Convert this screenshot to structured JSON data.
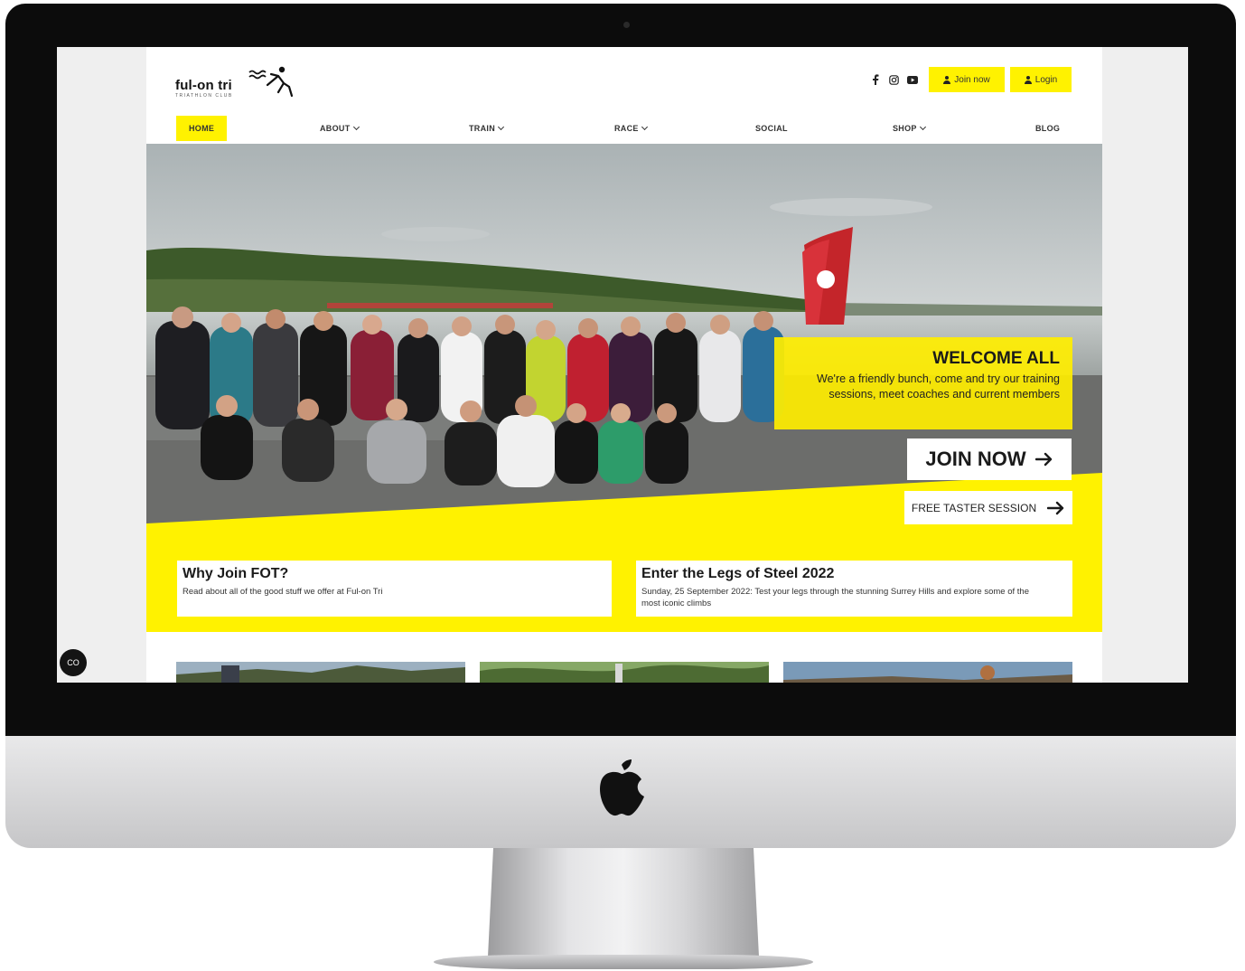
{
  "logo": {
    "text": "ful-on tri",
    "subtitle": "TRIATHLON CLUB"
  },
  "header": {
    "social_icons": [
      "facebook-icon",
      "instagram-icon",
      "youtube-icon"
    ],
    "join_label": "Join now",
    "login_label": "Login"
  },
  "nav": {
    "items": [
      {
        "label": "HOME",
        "active": true
      },
      {
        "label": "ABOUT",
        "dropdown": true
      },
      {
        "label": "TRAIN",
        "dropdown": true
      },
      {
        "label": "RACE",
        "dropdown": true
      },
      {
        "label": "SOCIAL"
      },
      {
        "label": "SHOP",
        "dropdown": true
      },
      {
        "label": "BLOG"
      }
    ]
  },
  "hero": {
    "welcome_title": "WELCOME ALL",
    "welcome_text": "We're a friendly bunch, come and try our training sessions, meet coaches and current members",
    "join_cta": "JOIN NOW",
    "taster_cta": "FREE TASTER SESSION"
  },
  "cards": [
    {
      "title": "Why Join FOT?",
      "text": "Read about all of the good stuff we offer at Ful-on Tri"
    },
    {
      "title": "Enter the Legs of Steel 2022",
      "text": "Sunday, 25 September 2022: Test your legs through the stunning Surrey Hills and explore some of the most iconic climbs"
    }
  ],
  "chat_widget": {
    "label": "CO"
  },
  "colors": {
    "accent": "#fff200",
    "text": "#1a1a1a",
    "page_bg": "#ffffff",
    "screen_bg": "#efefef",
    "bezel": "#0c0c0c"
  }
}
